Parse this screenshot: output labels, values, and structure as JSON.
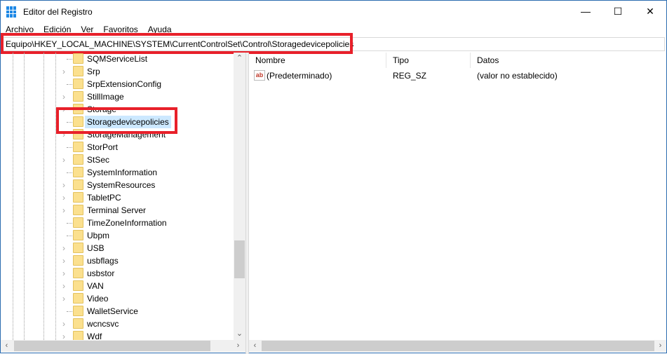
{
  "window": {
    "title": "Editor del Registro",
    "minimize": "—",
    "maximize": "☐",
    "close": "✕"
  },
  "menu": [
    "Archivo",
    "Edición",
    "Ver",
    "Favoritos",
    "Ayuda"
  ],
  "address": "Equipo\\HKEY_LOCAL_MACHINE\\SYSTEM\\CurrentControlSet\\Control\\Storagedevicepolicies",
  "tree": [
    {
      "label": "SQMServiceList",
      "expandable": false
    },
    {
      "label": "Srp",
      "expandable": true
    },
    {
      "label": "SrpExtensionConfig",
      "expandable": false
    },
    {
      "label": "StillImage",
      "expandable": true
    },
    {
      "label": "Storage",
      "expandable": true
    },
    {
      "label": "Storagedevicepolicies",
      "expandable": false,
      "selected": true
    },
    {
      "label": "StorageManagement",
      "expandable": true
    },
    {
      "label": "StorPort",
      "expandable": false
    },
    {
      "label": "StSec",
      "expandable": true
    },
    {
      "label": "SystemInformation",
      "expandable": false
    },
    {
      "label": "SystemResources",
      "expandable": true
    },
    {
      "label": "TabletPC",
      "expandable": true
    },
    {
      "label": "Terminal Server",
      "expandable": true
    },
    {
      "label": "TimeZoneInformation",
      "expandable": false
    },
    {
      "label": "Ubpm",
      "expandable": false
    },
    {
      "label": "USB",
      "expandable": true
    },
    {
      "label": "usbflags",
      "expandable": true
    },
    {
      "label": "usbstor",
      "expandable": true
    },
    {
      "label": "VAN",
      "expandable": true
    },
    {
      "label": "Video",
      "expandable": true
    },
    {
      "label": "WalletService",
      "expandable": false
    },
    {
      "label": "wcncsvc",
      "expandable": true
    },
    {
      "label": "Wdf",
      "expandable": true
    }
  ],
  "columns": {
    "name": "Nombre",
    "type": "Tipo",
    "data": "Datos"
  },
  "values": [
    {
      "name": "(Predeterminado)",
      "type": "REG_SZ",
      "data": "(valor no establecido)",
      "icon": "ab"
    }
  ],
  "colors": {
    "highlight": "#e8202a",
    "selection": "#cce8ff",
    "folder": "#fbe08e"
  }
}
